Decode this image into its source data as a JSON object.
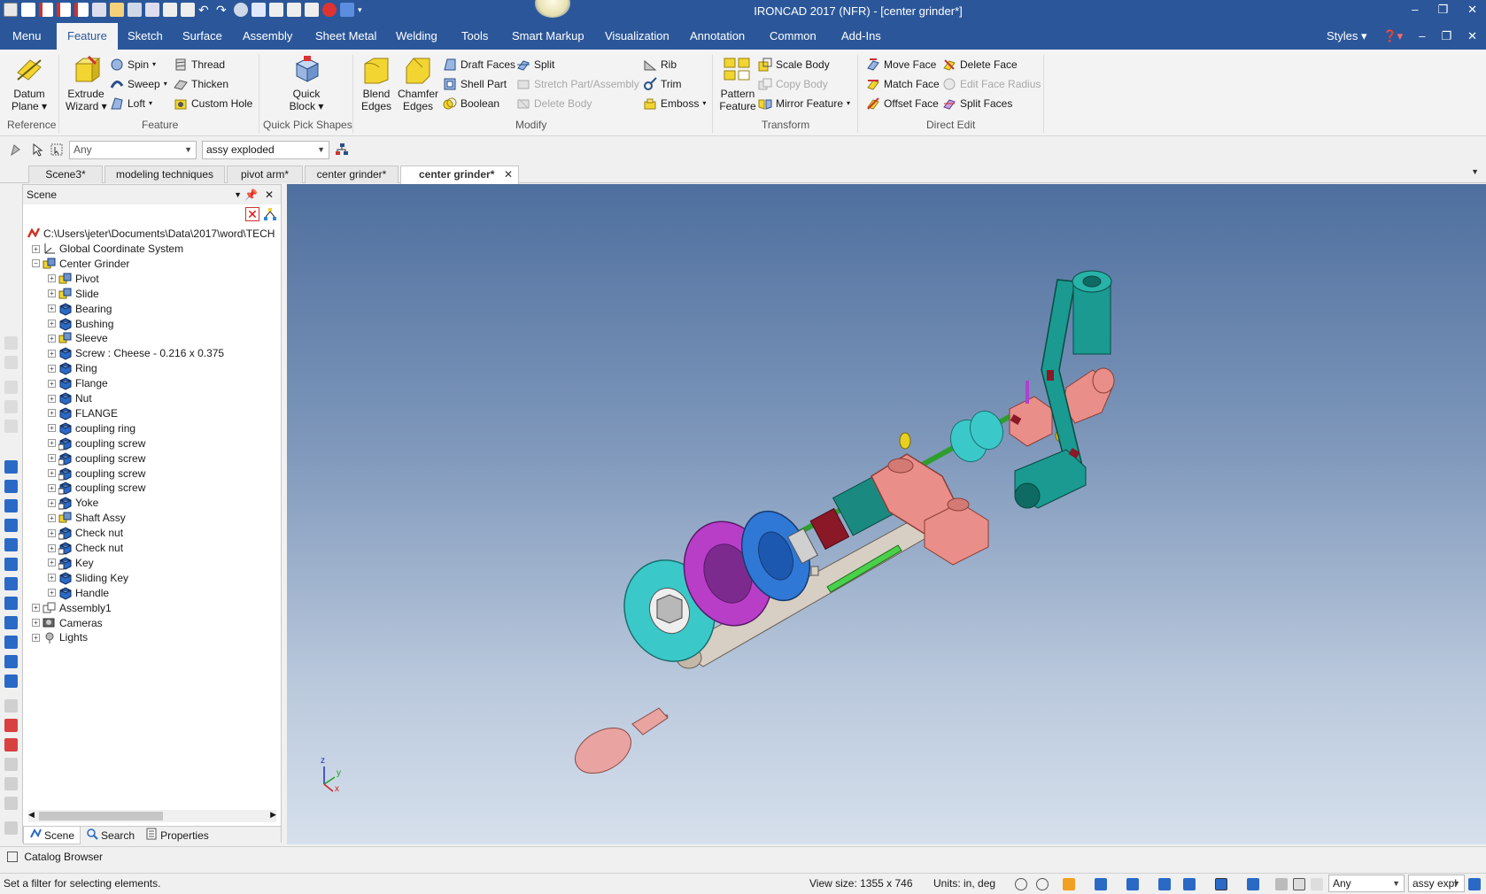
{
  "window": {
    "title": "IRONCAD 2017 (NFR) - [center grinder*]",
    "controls": [
      "–",
      "❐",
      "✕"
    ]
  },
  "ribbon_tabs": [
    "Menu",
    "Feature",
    "Sketch",
    "Surface",
    "Assembly",
    "Sheet Metal",
    "Welding",
    "Tools",
    "Smart Markup",
    "Visualization",
    "Annotation",
    "Common",
    "Add-Ins"
  ],
  "ribbon_right": {
    "styles": "Styles"
  },
  "groups": {
    "reference": {
      "label": "Reference",
      "datum_plane": [
        "Datum",
        "Plane ▾"
      ]
    },
    "feature": {
      "label": "Feature",
      "extrude_wizard": [
        "Extrude",
        "Wizard ▾"
      ],
      "spin": "Spin",
      "sweep": "Sweep",
      "loft": "Loft",
      "thread": "Thread",
      "thicken": "Thicken",
      "custom_hole": "Custom Hole"
    },
    "quick_pick": {
      "label": "Quick Pick Shapes",
      "quick_block": [
        "Quick",
        "Block ▾"
      ]
    },
    "modify": {
      "label": "Modify",
      "blend_edges": [
        "Blend",
        "Edges"
      ],
      "chamfer_edges": [
        "Chamfer",
        "Edges"
      ],
      "draft_faces": "Draft Faces",
      "shell_part": "Shell Part",
      "boolean": "Boolean",
      "split": "Split",
      "stretch": "Stretch Part/Assembly",
      "delete_body": "Delete Body",
      "rib": "Rib",
      "trim": "Trim",
      "emboss": "Emboss"
    },
    "transform": {
      "label": "Transform",
      "pattern_feature": [
        "Pattern",
        "Feature"
      ],
      "scale_body": "Scale Body",
      "copy_body": "Copy Body",
      "mirror_feature": "Mirror Feature"
    },
    "direct_edit": {
      "label": "Direct Edit",
      "move_face": "Move Face",
      "match_face": "Match Face",
      "offset_face": "Offset Face",
      "delete_face": "Delete Face",
      "edit_face_radius": "Edit Face Radius",
      "split_faces": "Split Faces"
    }
  },
  "filterbar": {
    "selection_filter": "Any",
    "configuration": "assy exploded"
  },
  "doc_tabs": [
    "Scene3*",
    "modeling techniques",
    "pivot arm*",
    "center grinder*",
    "center grinder*"
  ],
  "scene_panel": {
    "title": "Scene",
    "root": "C:\\Users\\jeter\\Documents\\Data\\2017\\word\\TECH",
    "items": [
      {
        "label": "Global Coordinate System",
        "level": 1,
        "icon": "coordinate-icon"
      },
      {
        "label": "Center Grinder",
        "level": 1,
        "icon": "assembly-icon",
        "expanded": true
      },
      {
        "label": "Pivot",
        "level": 2,
        "icon": "assembly-icon"
      },
      {
        "label": "Slide",
        "level": 2,
        "icon": "assembly-icon"
      },
      {
        "label": "Bearing",
        "level": 2,
        "icon": "part-icon"
      },
      {
        "label": "Bushing",
        "level": 2,
        "icon": "part-icon"
      },
      {
        "label": "Sleeve",
        "level": 2,
        "icon": "assembly-icon"
      },
      {
        "label": "Screw : Cheese - 0.216 x 0.375",
        "level": 2,
        "icon": "part-icon"
      },
      {
        "label": "Ring",
        "level": 2,
        "icon": "part-icon"
      },
      {
        "label": "Flange",
        "level": 2,
        "icon": "part-icon"
      },
      {
        "label": "Nut",
        "level": 2,
        "icon": "part-icon"
      },
      {
        "label": "FLANGE",
        "level": 2,
        "icon": "part-icon"
      },
      {
        "label": "coupling ring",
        "level": 2,
        "icon": "part-icon"
      },
      {
        "label": "coupling screw",
        "level": 2,
        "icon": "part-link-icon"
      },
      {
        "label": "coupling screw",
        "level": 2,
        "icon": "part-link-icon"
      },
      {
        "label": "coupling screw",
        "level": 2,
        "icon": "part-link-icon"
      },
      {
        "label": "coupling screw",
        "level": 2,
        "icon": "part-link-icon"
      },
      {
        "label": "Yoke",
        "level": 2,
        "icon": "part-link-icon"
      },
      {
        "label": "Shaft Assy",
        "level": 2,
        "icon": "assembly-icon"
      },
      {
        "label": "Check nut",
        "level": 2,
        "icon": "part-link-icon"
      },
      {
        "label": "Check nut",
        "level": 2,
        "icon": "part-link-icon"
      },
      {
        "label": "Key",
        "level": 2,
        "icon": "part-link-icon"
      },
      {
        "label": "Sliding Key",
        "level": 2,
        "icon": "part-icon"
      },
      {
        "label": "Handle",
        "level": 2,
        "icon": "part-icon"
      },
      {
        "label": "Assembly1",
        "level": 1,
        "icon": "assembly-outline-icon"
      },
      {
        "label": "Cameras",
        "level": 1,
        "icon": "camera-icon"
      },
      {
        "label": "Lights",
        "level": 1,
        "icon": "light-icon"
      }
    ],
    "tabs": [
      "Scene",
      "Search",
      "Properties"
    ]
  },
  "viewport": {
    "triad": {
      "z": "z",
      "y": "y",
      "x": "x"
    }
  },
  "catalog": "Catalog Browser",
  "status": {
    "message": "Set a filter for selecting elements.",
    "view_size": "View size: 1355 x  746",
    "units": "Units: in, deg",
    "filter": "Any",
    "config": "assy expl"
  }
}
